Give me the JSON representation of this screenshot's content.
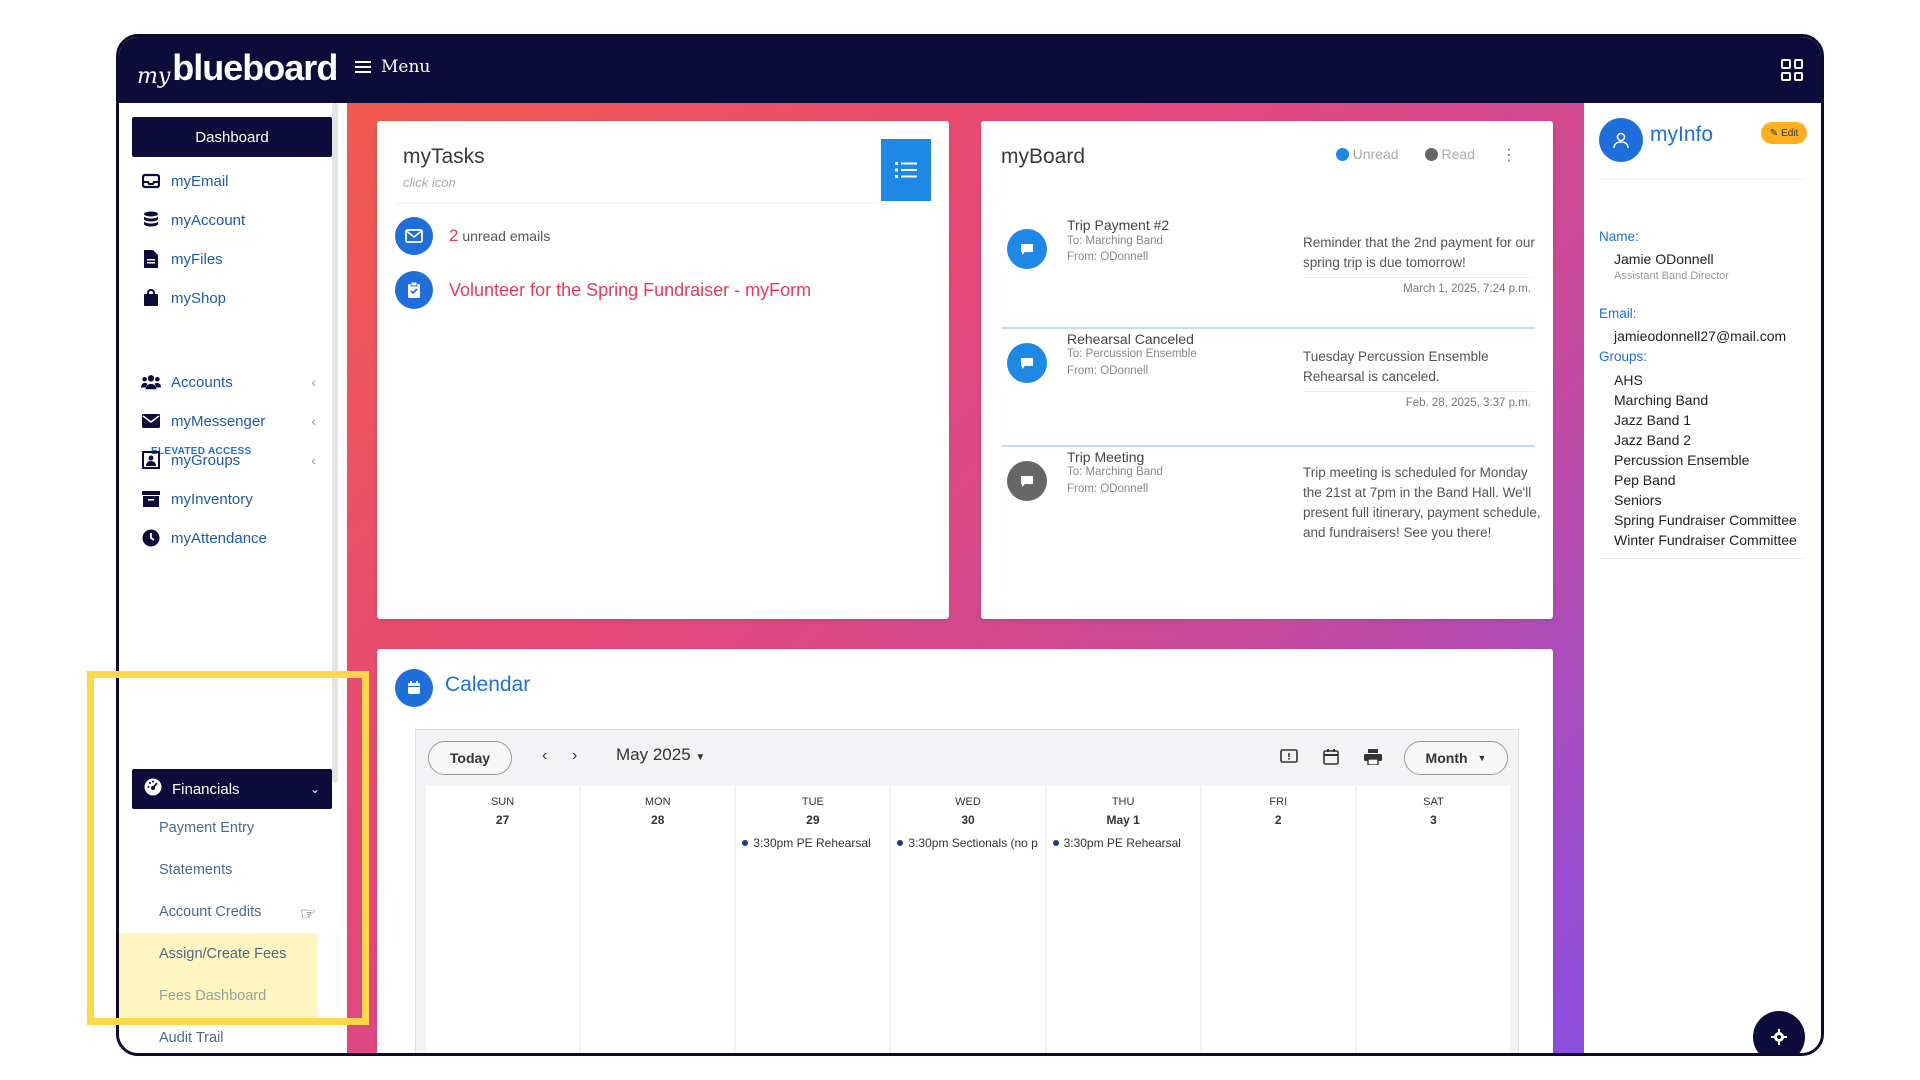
{
  "app": {
    "logo_prefix": "my",
    "logo_main": "blueboard",
    "menu_label": "Menu"
  },
  "sidebar": {
    "dashboard": "Dashboard",
    "items": [
      {
        "label": "myEmail",
        "icon": "inbox-icon"
      },
      {
        "label": "myAccount",
        "icon": "database-icon"
      },
      {
        "label": "myFiles",
        "icon": "file-icon"
      },
      {
        "label": "myShop",
        "icon": "shopping-bag-icon"
      }
    ],
    "section_label": "ELEVATED ACCESS",
    "elevated_items": [
      {
        "label": "Accounts",
        "icon": "users-icon"
      },
      {
        "label": "myMessenger",
        "icon": "envelope-icon"
      },
      {
        "label": "myGroups",
        "icon": "group-icon"
      },
      {
        "label": "myInventory",
        "icon": "archive-icon"
      },
      {
        "label": "myAttendance",
        "icon": "clock-icon"
      }
    ],
    "financials": "Financials",
    "financial_subitems": [
      "Payment Entry",
      "Statements",
      "Account Credits",
      "Assign/Create Fees",
      "Fees Dashboard",
      "Audit Trail"
    ]
  },
  "tasks": {
    "title": "myTasks",
    "hint": "click icon",
    "email_count": "2",
    "email_text": "unread emails",
    "form_link": "Volunteer for the Spring Fundraiser - myForm"
  },
  "board": {
    "title": "myBoard",
    "legend_unread": "Unread",
    "legend_read": "Read",
    "colors": {
      "unread": "#1e88e5",
      "read": "#666666"
    },
    "messages": [
      {
        "subject": "Trip Payment #2",
        "to": "To: Marching Band",
        "from": "From: ODonnell",
        "body": "Reminder that the 2nd payment for our spring trip is due tomorrow!",
        "timestamp": "March 1, 2025, 7:24 p.m.",
        "status": "unread"
      },
      {
        "subject": "Rehearsal Canceled",
        "to": "To: Percussion Ensemble",
        "from": "From: ODonnell",
        "body": "Tuesday Percussion Ensemble Rehearsal is canceled.",
        "timestamp": "Feb. 28, 2025, 3:37 p.m.",
        "status": "unread"
      },
      {
        "subject": "Trip Meeting",
        "to": "To: Marching Band",
        "from": "From: ODonnell",
        "body": "Trip meeting is scheduled for Monday the 21st at 7pm in the Band Hall. We'll present full itinerary, payment schedule, and fundraisers! See you there!",
        "timestamp": "",
        "status": "read"
      }
    ]
  },
  "calendar": {
    "title": "Calendar",
    "today_label": "Today",
    "month_label": "May 2025",
    "view_label": "Month",
    "days": [
      {
        "dow": "SUN",
        "num": "27",
        "event": ""
      },
      {
        "dow": "MON",
        "num": "28",
        "event": ""
      },
      {
        "dow": "TUE",
        "num": "29",
        "event": "3:30pm PE Rehearsal"
      },
      {
        "dow": "WED",
        "num": "30",
        "event": "3:30pm Sectionals (no p"
      },
      {
        "dow": "THU",
        "num": "May 1",
        "event": "3:30pm PE Rehearsal"
      },
      {
        "dow": "FRI",
        "num": "2",
        "event": ""
      },
      {
        "dow": "SAT",
        "num": "3",
        "event": ""
      }
    ]
  },
  "info": {
    "title": "myInfo",
    "edit_label": "Edit",
    "name_label": "Name:",
    "name": "Jamie ODonnell",
    "role": "Assistant Band Director",
    "email_label": "Email:",
    "email": "jamieodonnell27@mail.com",
    "groups_label": "Groups:",
    "groups": [
      "AHS",
      "Marching Band",
      "Jazz Band 1",
      "Jazz Band 2",
      "Percussion Ensemble",
      "Pep Band",
      "Seniors",
      "Spring Fundraiser Committee",
      "Winter Fundraiser Committee"
    ]
  },
  "accent": {
    "brand_navy": "#0d0b3a",
    "primary_blue": "#1e6fd9",
    "alert_red": "#e8395a",
    "highlight_yellow": "#ffd84a"
  }
}
